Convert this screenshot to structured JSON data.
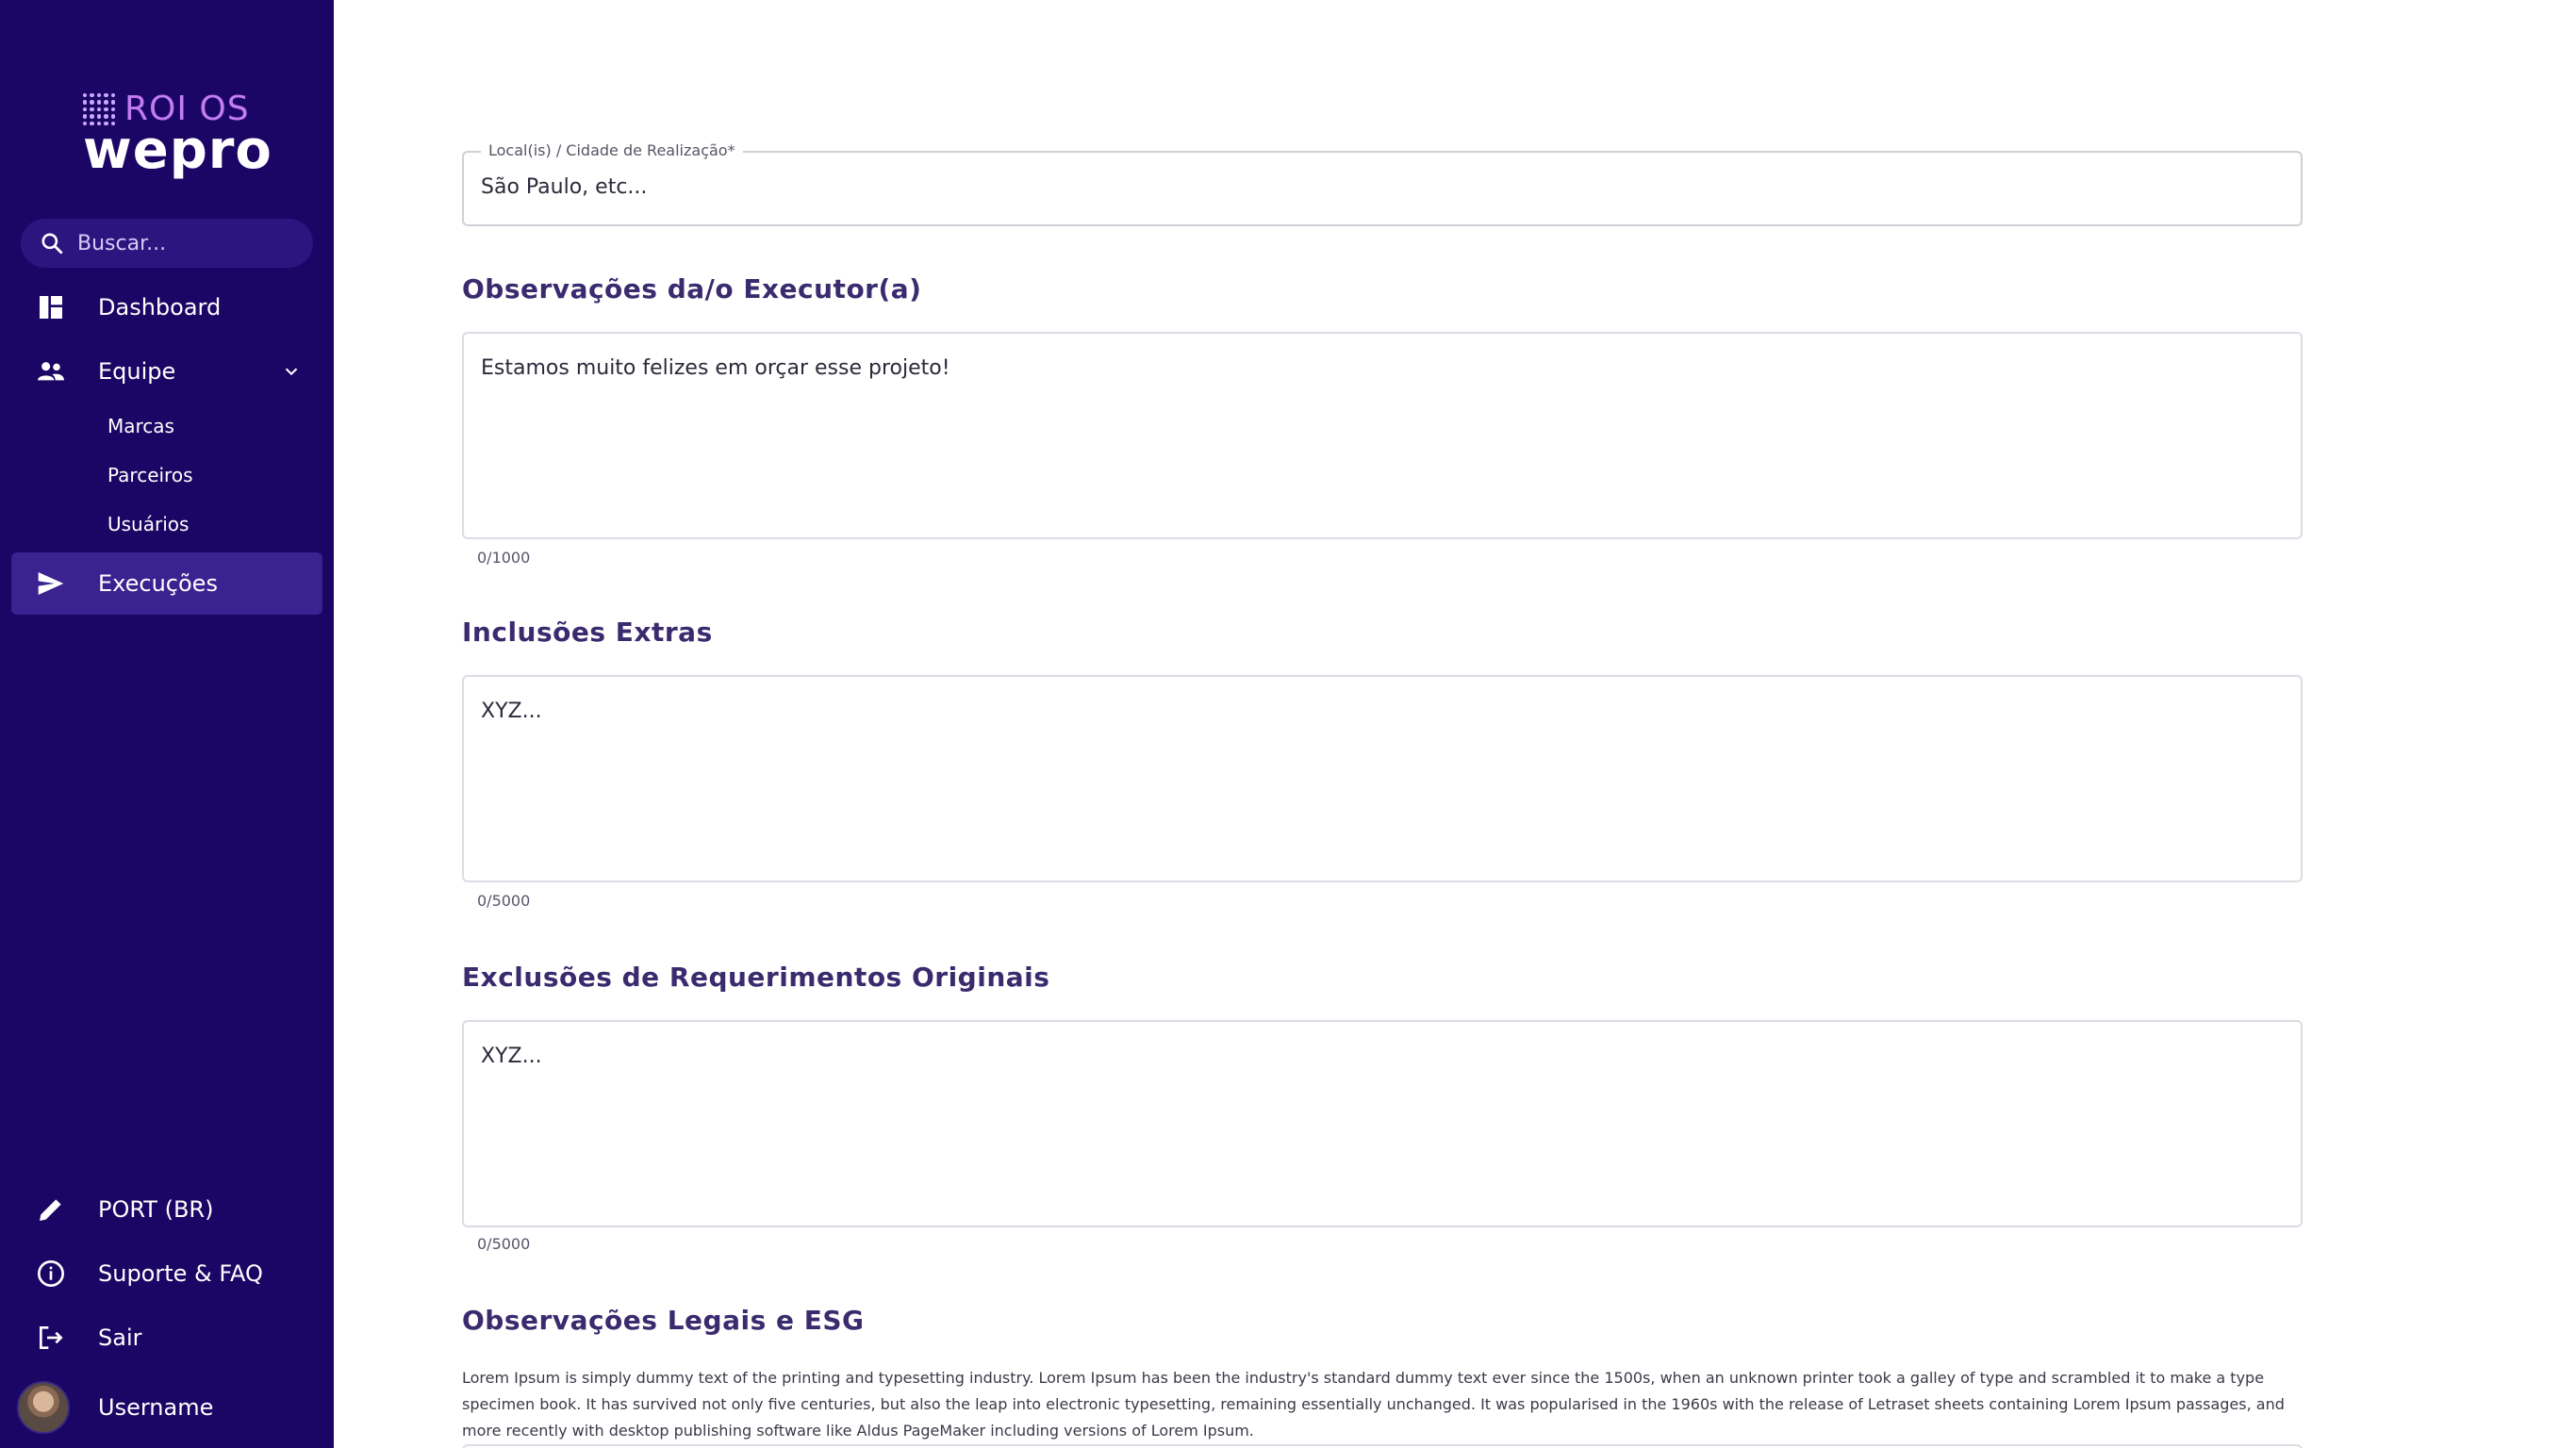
{
  "brand": {
    "top": "ROI OS",
    "main": "wepro"
  },
  "search": {
    "placeholder": "Buscar..."
  },
  "nav": {
    "dashboard": "Dashboard",
    "equipe": "Equipe",
    "sub_items": [
      "Marcas",
      "Parceiros",
      "Usuários"
    ],
    "execucoes": "Execuções"
  },
  "footer_nav": {
    "language": "PORT (BR)",
    "support": "Suporte & FAQ",
    "logout": "Sair",
    "username": "Username"
  },
  "form": {
    "location": {
      "label": "Local(is) / Cidade de Realização*",
      "value": "São Paulo, etc..."
    },
    "observacoes": {
      "title": "Observações da/o Executor(a)",
      "value": "Estamos muito felizes em orçar esse projeto!",
      "counter": "0/1000"
    },
    "inclusoes": {
      "title": "Inclusões Extras",
      "value": "XYZ...",
      "counter": "0/5000"
    },
    "exclusoes": {
      "title": "Exclusões de Requerimentos Originais",
      "value": "XYZ...",
      "counter": "0/5000"
    },
    "legais": {
      "title": "Observações Legais e ESG",
      "text": "Lorem Ipsum is simply dummy text of the printing and typesetting industry. Lorem Ipsum has been the industry's standard dummy text ever since the 1500s, when an unknown printer took a galley of type and scrambled it to make a type specimen book. It has survived not only five centuries, but also the leap into electronic typesetting, remaining essentially unchanged. It was popularised in the 1960s with the release of Letraset sheets containing Lorem Ipsum passages, and more recently with desktop publishing software like Aldus PageMaker including versions of Lorem Ipsum."
    }
  },
  "colors": {
    "sidebar": "#1c0665",
    "active_item": "#3b2290",
    "title": "#3a2a6e"
  },
  "icons": {
    "dashboard": "dashboard-icon",
    "equipe": "people-icon",
    "execucoes": "send-icon",
    "language": "pencil-icon",
    "support": "info-icon",
    "logout": "logout-icon"
  }
}
